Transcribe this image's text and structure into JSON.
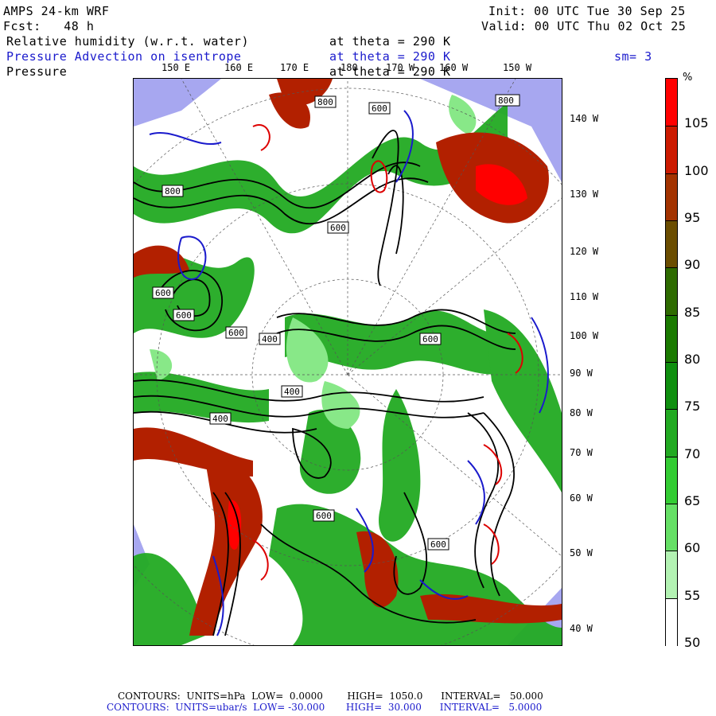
{
  "header": {
    "model": "AMPS 24-km WRF",
    "forecast": "Fcst:   48 h",
    "init": "Init: 00 UTC Tue 30 Sep 25",
    "valid": "Valid: 00 UTC Thu 02 Oct 25",
    "field1_name": "Relative humidity (w.r.t. water)",
    "field1_level": "at theta = 290 K",
    "field2_name": "Pressure Advection on isentrope",
    "field2_level": "at theta = 290 K",
    "smoothing": "sm= 3",
    "field3_name": "Pressure",
    "field3_level": "at theta = 290 K"
  },
  "longitude_labels": [
    "150 E",
    "160 E",
    "170 E",
    "180",
    "170 W",
    "160 W",
    "150 W"
  ],
  "latitude_labels": [
    "140 W",
    "130 W",
    "120 W",
    "110 W",
    "100 W",
    "90 W",
    "80 W",
    "70 W",
    "60 W",
    "50 W",
    "40 W"
  ],
  "contour_labels": [
    "600",
    "800",
    "600",
    "600",
    "600",
    "600",
    "400",
    "400",
    "600",
    "600",
    "600",
    "800",
    "800",
    "400"
  ],
  "colorbar": {
    "unit": "%",
    "labels": [
      "105",
      "100",
      "95",
      "90",
      "85",
      "80",
      "75",
      "70",
      "65",
      "60",
      "55",
      "50"
    ],
    "colors": [
      "#ff0000",
      "#cc1a00",
      "#a33300",
      "#6b4d00",
      "#2e6b00",
      "#1a7a00",
      "#0f8f0f",
      "#22aa22",
      "#33cc33",
      "#66e066",
      "#b3f2b3",
      "#ffffff"
    ]
  },
  "footer": {
    "line1": "CONTOURS:  UNITS=hPa  LOW=  0.0000        HIGH=  1050.0      INTERVAL=   50.000",
    "line2": "CONTOURS:  UNITS=ubar/s  LOW= -30.000       HIGH=  30.000      INTERVAL=   5.0000"
  }
}
